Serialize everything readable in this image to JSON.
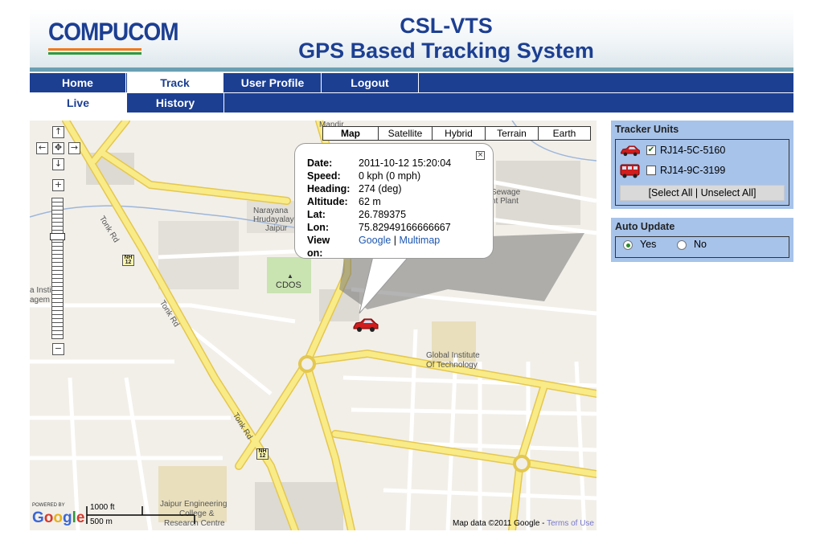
{
  "header": {
    "logo_text": "COMPUCOM",
    "title": "CSL-VTS",
    "subtitle": "GPS Based Tracking System"
  },
  "nav": {
    "tabs": [
      {
        "label": "Home",
        "active": false
      },
      {
        "label": "Track",
        "active": true
      },
      {
        "label": "User Profile",
        "active": false
      },
      {
        "label": "Logout",
        "active": false
      }
    ],
    "subtabs": [
      {
        "label": "Live",
        "active": true
      },
      {
        "label": "History",
        "active": false
      }
    ]
  },
  "map": {
    "types": [
      {
        "label": "Map",
        "active": true
      },
      {
        "label": "Satellite",
        "active": false
      },
      {
        "label": "Hybrid",
        "active": false
      },
      {
        "label": "Terrain",
        "active": false
      },
      {
        "label": "Earth",
        "active": false
      }
    ],
    "info_window": {
      "rows": [
        {
          "label": "Date:",
          "value": "2011-10-12 15:20:04"
        },
        {
          "label": "Speed:",
          "value": "0 kph (0 mph)"
        },
        {
          "label": "Heading:",
          "value": "274 (deg)"
        },
        {
          "label": "Altitude:",
          "value": "62 m"
        },
        {
          "label": "Lat:",
          "value": "26.789375"
        },
        {
          "label": "Lon:",
          "value": "75.82949166666667"
        }
      ],
      "view_on_label": "View on:",
      "link_google": "Google",
      "link_separator": "|",
      "link_multimap": "Multimap"
    },
    "labels": {
      "mandir": "Mandir",
      "narayana_1": "Narayana",
      "narayana_2": "Hrudayalaya",
      "narayana_3": "Jaipur",
      "cdos": "CDOS",
      "sewage_1": "Sewage",
      "sewage_2": "nt Plant",
      "global_1": "Global Institute",
      "global_2": "Of Technology",
      "jaipur_eng_1": "Jaipur Engineering",
      "jaipur_eng_2": "College &",
      "jaipur_eng_3": "Research Centre",
      "left_1": "a Insti",
      "left_2": "agem",
      "tonk_rd": "Tonk Rd",
      "nh": "NH",
      "nh_num": "12"
    },
    "attribution": {
      "powered_by": "POWERED BY",
      "google": "Google",
      "scale_ft": "1000 ft",
      "scale_m": "500 m",
      "map_data": "Map data ©2011 Google - ",
      "terms": "Terms of Use"
    }
  },
  "tracker_units": {
    "title": "Tracker Units",
    "units": [
      {
        "id": "RJ14-5C-5160",
        "checked": true,
        "icon": "car-icon"
      },
      {
        "id": "RJ14-9C-3199",
        "checked": false,
        "icon": "bus-icon"
      }
    ],
    "select_all_label": "[Select All | Unselect All]"
  },
  "auto_update": {
    "title": "Auto Update",
    "options": [
      {
        "label": "Yes",
        "selected": true
      },
      {
        "label": "No",
        "selected": false
      }
    ]
  },
  "colors": {
    "brand_blue": "#1c3f92",
    "panel_blue": "#a7c3ea",
    "road_yellow": "#f7e47a",
    "map_background": "#f2efe9"
  }
}
